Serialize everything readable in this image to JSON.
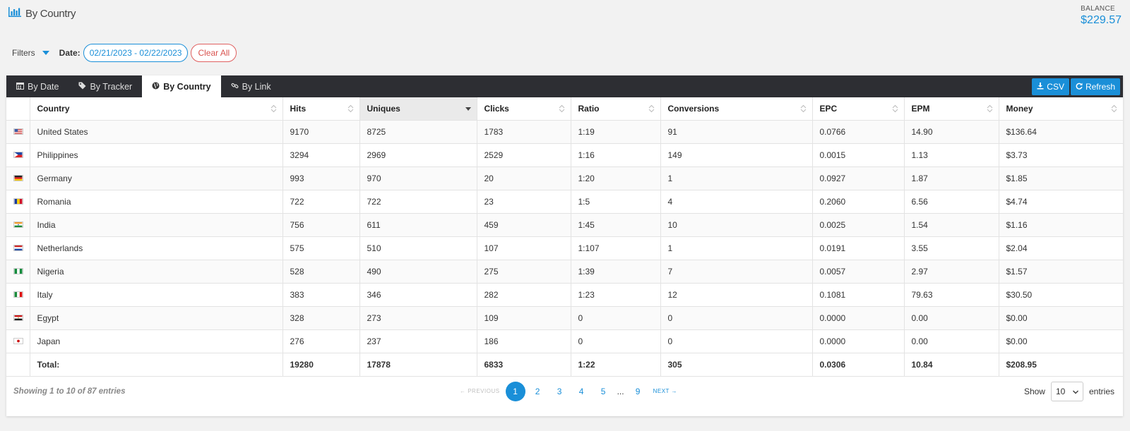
{
  "page": {
    "title": "By Country",
    "title_icon": "bar-chart-icon"
  },
  "balance": {
    "label": "BALANCE",
    "value": "$229.57"
  },
  "filters": {
    "label": "Filters",
    "date_label": "Date:",
    "date_range": "02/21/2023 - 02/22/2023",
    "clear_label": "Clear All"
  },
  "tabs": [
    {
      "label": "By Date",
      "icon": "calendar-icon",
      "active": false
    },
    {
      "label": "By Tracker",
      "icon": "tag-icon",
      "active": false
    },
    {
      "label": "By Country",
      "icon": "globe-icon",
      "active": true
    },
    {
      "label": "By Link",
      "icon": "link-icon",
      "active": false
    }
  ],
  "toolbar": {
    "csv_label": "CSV",
    "refresh_label": "Refresh"
  },
  "table": {
    "columns": [
      "",
      "Country",
      "Hits",
      "Uniques",
      "Clicks",
      "Ratio",
      "Conversions",
      "EPC",
      "EPM",
      "Money"
    ],
    "sorted_column": "Uniques",
    "rows": [
      {
        "flag": "us",
        "country": "United States",
        "hits": "9170",
        "uniques": "8725",
        "clicks": "1783",
        "ratio": "1:19",
        "conversions": "91",
        "epc": "0.0766",
        "epm": "14.90",
        "money": "$136.64"
      },
      {
        "flag": "ph",
        "country": "Philippines",
        "hits": "3294",
        "uniques": "2969",
        "clicks": "2529",
        "ratio": "1:16",
        "conversions": "149",
        "epc": "0.0015",
        "epm": "1.13",
        "money": "$3.73"
      },
      {
        "flag": "de",
        "country": "Germany",
        "hits": "993",
        "uniques": "970",
        "clicks": "20",
        "ratio": "1:20",
        "conversions": "1",
        "epc": "0.0927",
        "epm": "1.87",
        "money": "$1.85"
      },
      {
        "flag": "ro",
        "country": "Romania",
        "hits": "722",
        "uniques": "722",
        "clicks": "23",
        "ratio": "1:5",
        "conversions": "4",
        "epc": "0.2060",
        "epm": "6.56",
        "money": "$4.74"
      },
      {
        "flag": "in",
        "country": "India",
        "hits": "756",
        "uniques": "611",
        "clicks": "459",
        "ratio": "1:45",
        "conversions": "10",
        "epc": "0.0025",
        "epm": "1.54",
        "money": "$1.16"
      },
      {
        "flag": "nl",
        "country": "Netherlands",
        "hits": "575",
        "uniques": "510",
        "clicks": "107",
        "ratio": "1:107",
        "conversions": "1",
        "epc": "0.0191",
        "epm": "3.55",
        "money": "$2.04"
      },
      {
        "flag": "ng",
        "country": "Nigeria",
        "hits": "528",
        "uniques": "490",
        "clicks": "275",
        "ratio": "1:39",
        "conversions": "7",
        "epc": "0.0057",
        "epm": "2.97",
        "money": "$1.57"
      },
      {
        "flag": "it",
        "country": "Italy",
        "hits": "383",
        "uniques": "346",
        "clicks": "282",
        "ratio": "1:23",
        "conversions": "12",
        "epc": "0.1081",
        "epm": "79.63",
        "money": "$30.50"
      },
      {
        "flag": "eg",
        "country": "Egypt",
        "hits": "328",
        "uniques": "273",
        "clicks": "109",
        "ratio": "0",
        "conversions": "0",
        "epc": "0.0000",
        "epm": "0.00",
        "money": "$0.00"
      },
      {
        "flag": "jp",
        "country": "Japan",
        "hits": "276",
        "uniques": "237",
        "clicks": "186",
        "ratio": "0",
        "conversions": "0",
        "epc": "0.0000",
        "epm": "0.00",
        "money": "$0.00"
      }
    ],
    "total": {
      "label": "Total:",
      "hits": "19280",
      "uniques": "17878",
      "clicks": "6833",
      "ratio": "1:22",
      "conversions": "305",
      "epc": "0.0306",
      "epm": "10.84",
      "money": "$208.95"
    }
  },
  "footer": {
    "showing": "Showing 1 to 10 of 87 entries",
    "prev_label": "← PREVIOUS",
    "next_label": "NEXT →",
    "pages": [
      "1",
      "2",
      "3",
      "4",
      "5"
    ],
    "ellipsis": "...",
    "last_page": "9",
    "current_page": "1",
    "show_label": "Show",
    "page_length": "10",
    "entries_label": "entries"
  },
  "colors": {
    "accent": "#1a8fd8",
    "tabbar": "#2d2e33",
    "danger": "#d9534f"
  }
}
